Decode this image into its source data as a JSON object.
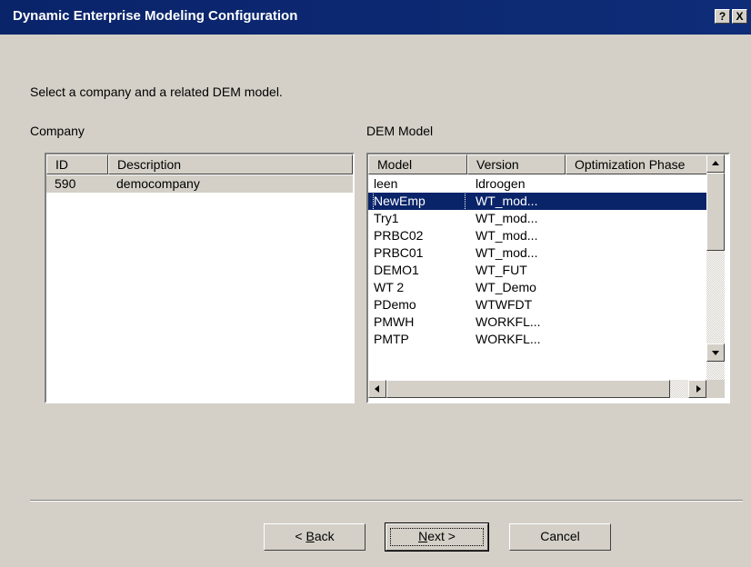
{
  "window": {
    "title": "Dynamic Enterprise Modeling Configuration",
    "help_label": "?",
    "close_label": "X"
  },
  "instruction": "Select a company and a related DEM model.",
  "company": {
    "label": "Company",
    "columns": [
      "ID",
      "Description"
    ],
    "rows": [
      {
        "id": "590",
        "description": "democompany",
        "selected": true
      }
    ]
  },
  "dem_model": {
    "label": "DEM Model",
    "columns": [
      "Model",
      "Version",
      "Optimization Phase"
    ],
    "rows": [
      {
        "model": "leen",
        "version": "ldroogen"
      },
      {
        "model": "NewEmp",
        "version": "WT_mod...",
        "selected": true
      },
      {
        "model": "Try1",
        "version": "WT_mod..."
      },
      {
        "model": "PRBC02",
        "version": "WT_mod..."
      },
      {
        "model": "PRBC01",
        "version": "WT_mod..."
      },
      {
        "model": "DEMO1",
        "version": "WT_FUT"
      },
      {
        "model": "WT 2",
        "version": "WT_Demo"
      },
      {
        "model": "PDemo",
        "version": "WTWFDT"
      },
      {
        "model": "PMWH",
        "version": "WORKFL..."
      },
      {
        "model": "PMTP",
        "version": "WORKFL..."
      }
    ]
  },
  "buttons": {
    "back_mnemonic": "B",
    "back_rest": "ack",
    "back_prefix": "< ",
    "next_mnemonic": "N",
    "next_rest": "ext >",
    "cancel": "Cancel"
  }
}
